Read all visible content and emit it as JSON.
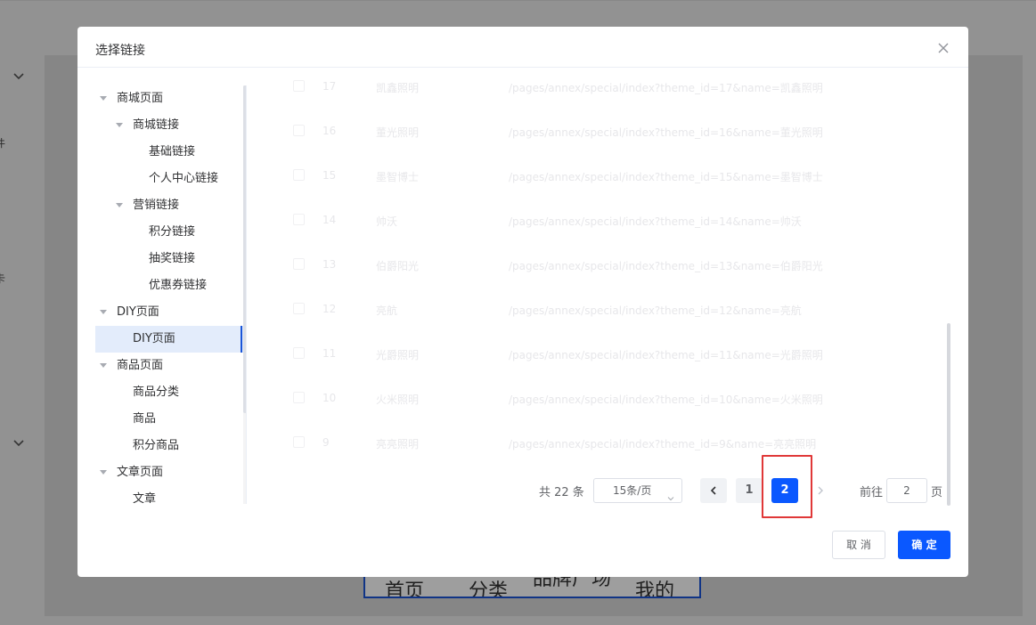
{
  "background": {
    "left_edge_labels": [
      "件",
      "卡"
    ],
    "tabbar": [
      "首页",
      "分类",
      "品牌广场",
      "我的"
    ]
  },
  "dialog": {
    "title": "选择链接",
    "close_icon": "close-icon"
  },
  "tree": [
    {
      "label": "商城页面",
      "level": 0,
      "expanded": true
    },
    {
      "label": "商城链接",
      "level": 1,
      "expanded": true
    },
    {
      "label": "基础链接",
      "level": 2
    },
    {
      "label": "个人中心链接",
      "level": 2
    },
    {
      "label": "营销链接",
      "level": 1,
      "expanded": true
    },
    {
      "label": "积分链接",
      "level": 2
    },
    {
      "label": "抽奖链接",
      "level": 2
    },
    {
      "label": "优惠券链接",
      "level": 2
    },
    {
      "label": "DIY页面",
      "level": 0,
      "expanded": true
    },
    {
      "label": "DIY页面",
      "level": 1,
      "active": true
    },
    {
      "label": "商品页面",
      "level": 0,
      "expanded": true
    },
    {
      "label": "商品分类",
      "level": 1
    },
    {
      "label": "商品",
      "level": 1
    },
    {
      "label": "积分商品",
      "level": 1
    },
    {
      "label": "文章页面",
      "level": 0,
      "expanded": true
    },
    {
      "label": "文章",
      "level": 1
    }
  ],
  "table_rows": [
    {
      "id": "17",
      "name": "凯鑫照明",
      "url": "/pages/annex/special/index?theme_id=17&name=凯鑫照明"
    },
    {
      "id": "16",
      "name": "董光照明",
      "url": "/pages/annex/special/index?theme_id=16&name=董光照明"
    },
    {
      "id": "15",
      "name": "墨智博士",
      "url": "/pages/annex/special/index?theme_id=15&name=墨智博士"
    },
    {
      "id": "14",
      "name": "帅沃",
      "url": "/pages/annex/special/index?theme_id=14&name=帅沃"
    },
    {
      "id": "13",
      "name": "伯爵阳光",
      "url": "/pages/annex/special/index?theme_id=13&name=伯爵阳光"
    },
    {
      "id": "12",
      "name": "亮航",
      "url": "/pages/annex/special/index?theme_id=12&name=亮航"
    },
    {
      "id": "11",
      "name": "光爵照明",
      "url": "/pages/annex/special/index?theme_id=11&name=光爵照明"
    },
    {
      "id": "10",
      "name": "火米照明",
      "url": "/pages/annex/special/index?theme_id=10&name=火米照明"
    },
    {
      "id": "9",
      "name": "亮亮照明",
      "url": "/pages/annex/special/index?theme_id=9&name=亮亮照明"
    }
  ],
  "pagination": {
    "total": "共 22 条",
    "page_size": "15条/页",
    "pages": [
      "1",
      "2"
    ],
    "current_page": "2",
    "goto_label": "前往",
    "goto_value": "2",
    "page_suffix": "页"
  },
  "footer": {
    "cancel_label": "取 消",
    "ok_label": "确 定"
  },
  "colors": {
    "primary": "#0a58ff",
    "highlight": "#e03838",
    "tree_active_bg": "#e3ecfb"
  }
}
